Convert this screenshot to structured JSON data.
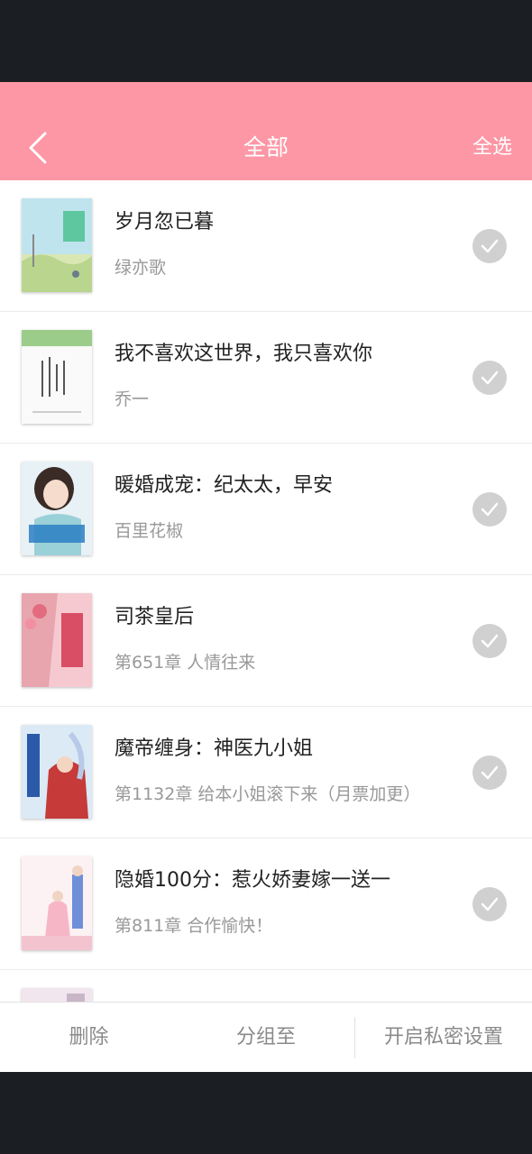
{
  "header": {
    "title": "全部",
    "select_all": "全选",
    "bg_color": "#fd97a5"
  },
  "books": [
    {
      "title": "岁月忽已暮",
      "subtitle": "绿亦歌",
      "cover_icon": "book-cover-1"
    },
    {
      "title": "我不喜欢这世界，我只喜欢你",
      "subtitle": "乔一",
      "cover_icon": "book-cover-2"
    },
    {
      "title": "暖婚成宠：纪太太，早安",
      "subtitle": "百里花椒",
      "cover_icon": "book-cover-3"
    },
    {
      "title": "司茶皇后",
      "subtitle": "第651章 人情往来",
      "cover_icon": "book-cover-4"
    },
    {
      "title": "魔帝缠身：神医九小姐",
      "subtitle": "第1132章 给本小姐滚下来（月票加更）",
      "cover_icon": "book-cover-5"
    },
    {
      "title": "隐婚100分：惹火娇妻嫁一送一",
      "subtitle": "第811章 合作愉快！",
      "cover_icon": "book-cover-6"
    }
  ],
  "bottom": {
    "delete": "删除",
    "group_to": "分组至",
    "private": "开启私密设置"
  }
}
